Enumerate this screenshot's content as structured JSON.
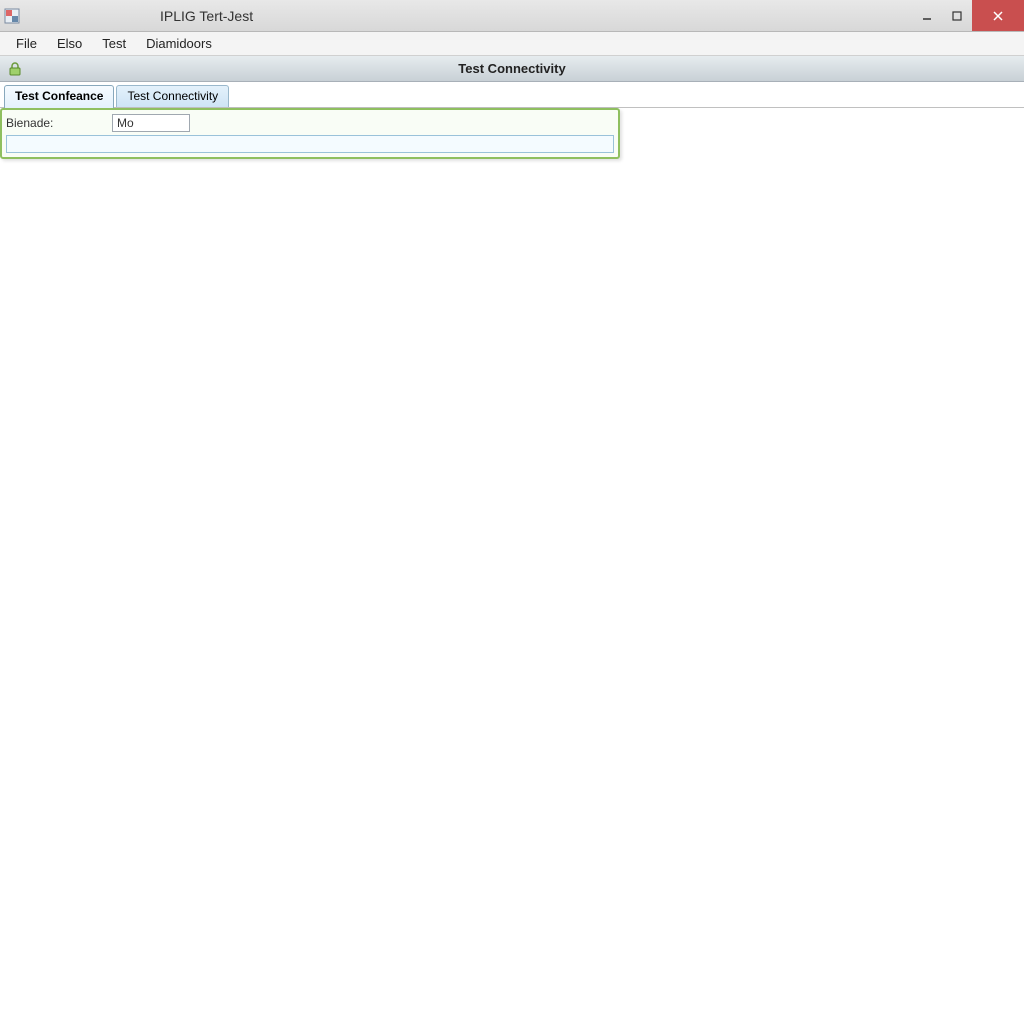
{
  "window": {
    "title": "IPLIG Tert-Jest"
  },
  "menubar": {
    "items": [
      "File",
      "Elso",
      "Test",
      "Diamidoors"
    ]
  },
  "toolbar": {
    "title": "Test Connectivity"
  },
  "tabs": {
    "items": [
      {
        "label": "Test Confeance",
        "active": true
      },
      {
        "label": "Test Connectivity",
        "active": false
      }
    ]
  },
  "form": {
    "field_label": "Bienade:",
    "field_value": "Mo",
    "secondary_value": ""
  }
}
